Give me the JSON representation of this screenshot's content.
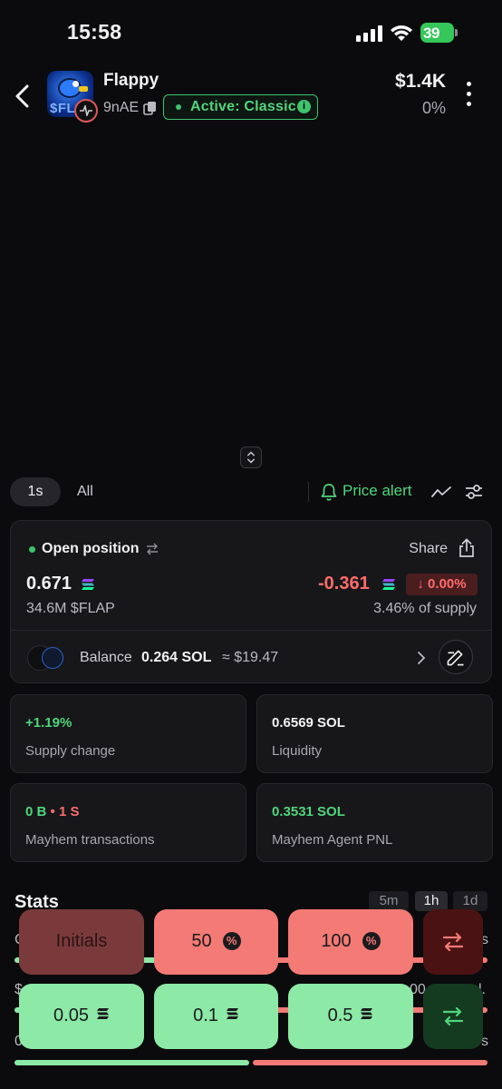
{
  "status_bar": {
    "time": "15:58",
    "battery": "39"
  },
  "header": {
    "token_name": "Flappy",
    "token_address": "9nAE",
    "avatar_text": "$FL",
    "active_badge": "Active: Classic",
    "market_cap": "$1.4K",
    "change_pct": "0%"
  },
  "timeframes": {
    "selected": "1s",
    "all": "All",
    "price_alert": "Price alert"
  },
  "position": {
    "title": "Open position",
    "share": "Share",
    "value": "0.671",
    "tokens": "34.6M $FLAP",
    "pnl": "-0.361",
    "pnl_pct": "↓ 0.00%",
    "supply_pct": "3.46% of supply",
    "balance_label": "Balance",
    "balance_value": "0.264 SOL",
    "balance_usd": "≈ $19.47"
  },
  "metrics": {
    "supply_change": {
      "value": "+1.19%",
      "label": "Supply change"
    },
    "liquidity": {
      "value": "0.6569 SOL",
      "label": "Liquidity"
    },
    "mayhem_tx": {
      "buys": "0 B",
      "sep": " • ",
      "sells": "1 S",
      "label": "Mayhem transactions"
    },
    "agent_pnl": {
      "value": "0.3531 SOL",
      "label": "Mayhem Agent PNL"
    }
  },
  "stats": {
    "title": "Stats",
    "tabs": [
      "5m",
      "1h",
      "1d"
    ],
    "selected_tab": "1h",
    "row_edges": [
      "C",
      "s",
      "$",
      "00",
      "l.",
      "0",
      "s"
    ],
    "buy_sell_ratio": [
      0.5,
      0.5
    ]
  },
  "quick_sell": {
    "initials": "Initials",
    "pct_icon": "%",
    "options": [
      "50",
      "100"
    ]
  },
  "quick_buy": {
    "options": [
      "0.05",
      "0.1",
      "0.5"
    ]
  },
  "colors": {
    "accent_green": "#4fd67b",
    "accent_red": "#ff6b6b",
    "buy_button": "#8ce9a6",
    "sell_button": "#f47a76"
  },
  "icons": [
    "back-icon",
    "copy-icon",
    "info-icon",
    "more-icon",
    "bell-icon",
    "line-chart-icon",
    "sliders-icon",
    "swap-icon",
    "share-icon",
    "solana-icon",
    "edit-icon",
    "chevron-right-icon"
  ]
}
